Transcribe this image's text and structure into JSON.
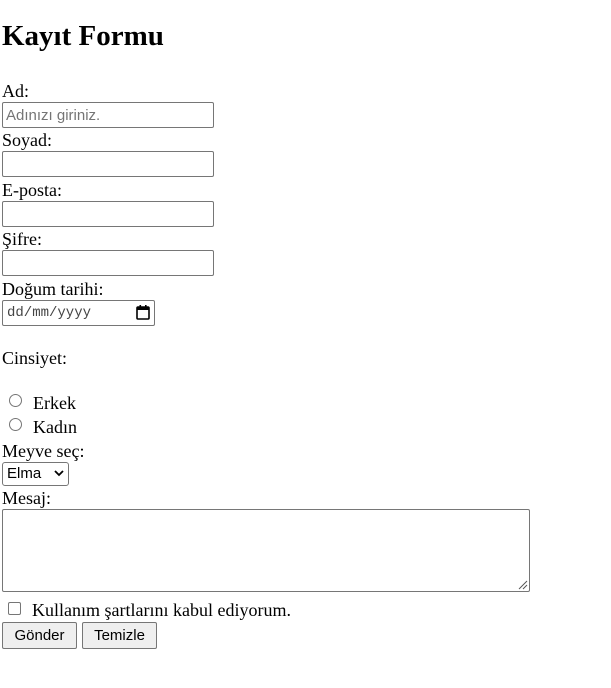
{
  "form": {
    "title": "Kayıt Formu",
    "name_label": "Ad:",
    "name_placeholder": "Adınızı giriniz.",
    "surname_label": "Soyad:",
    "email_label": "E-posta:",
    "password_label": "Şifre:",
    "birthdate_label": "Doğum tarihi:",
    "birthdate_placeholder": "dd/mm/yyyy",
    "gender_label": "Cinsiyet:",
    "gender_options": [
      "Erkek",
      "Kadın"
    ],
    "fruit_label": "Meyve seç:",
    "fruit_selected": "Elma",
    "message_label": "Mesaj:",
    "terms_label": "Kullanım şartlarını kabul ediyorum.",
    "submit_label": "Gönder",
    "reset_label": "Temizle"
  }
}
